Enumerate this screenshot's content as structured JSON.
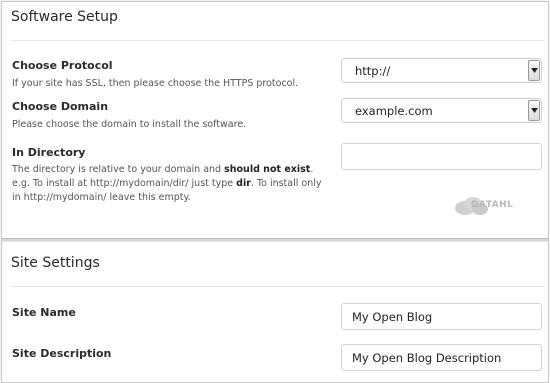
{
  "software_setup": {
    "title": "Software Setup",
    "protocol": {
      "label": "Choose Protocol",
      "description": "If your site has SSL, then please choose the HTTPS protocol.",
      "value": "http://"
    },
    "domain": {
      "label": "Choose Domain",
      "description": "Please choose the domain to install the software.",
      "value": "example.com"
    },
    "directory": {
      "label": "In Directory",
      "desc_part1": "The directory is relative to your domain and ",
      "desc_bold1": "should not exist",
      "desc_part2": ". e.g. To install at http://mydomain/dir/ just type ",
      "desc_bold2": "dir",
      "desc_part3": ". To install only in http://mydomain/ leave this empty.",
      "value": ""
    },
    "watermark": "DATAHL"
  },
  "site_settings": {
    "title": "Site Settings",
    "site_name": {
      "label": "Site Name",
      "value": "My Open Blog"
    },
    "site_description": {
      "label": "Site Description",
      "value": "My Open Blog Description"
    }
  }
}
